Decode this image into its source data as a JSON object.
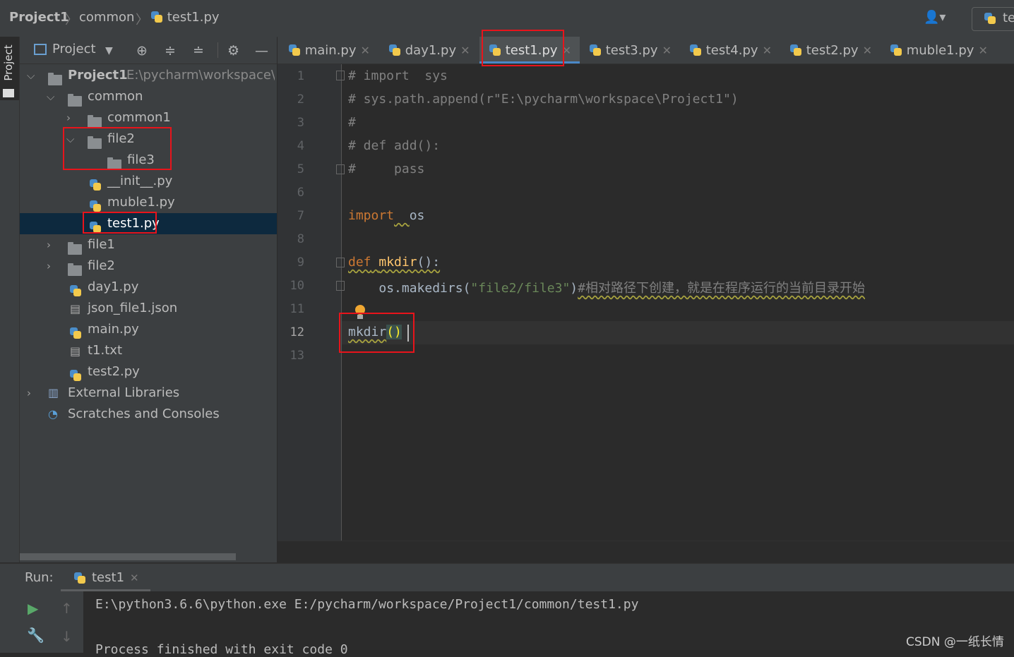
{
  "breadcrumb": {
    "project": "Project1",
    "folder": "common",
    "file": "test1.py",
    "run_config": "te"
  },
  "sidebar_stripe": {
    "label": "Project"
  },
  "project_toolbar": {
    "view_label": "Project"
  },
  "tree": [
    {
      "label": "Project1",
      "path": "E:\\pycharm\\workspace\\P",
      "type": "folder",
      "expanded": true
    },
    {
      "label": "common",
      "type": "folder",
      "expanded": true
    },
    {
      "label": "common1",
      "type": "folder",
      "expanded": false
    },
    {
      "label": "file2",
      "type": "folder",
      "expanded": true
    },
    {
      "label": "file3",
      "type": "folder"
    },
    {
      "label": "__init__.py",
      "type": "python"
    },
    {
      "label": "muble1.py",
      "type": "python"
    },
    {
      "label": "test1.py",
      "type": "python",
      "selected": true
    },
    {
      "label": "file1",
      "type": "folder",
      "expanded": false
    },
    {
      "label": "file2",
      "type": "folder",
      "expanded": false
    },
    {
      "label": "day1.py",
      "type": "python"
    },
    {
      "label": "json_file1.json",
      "type": "json"
    },
    {
      "label": "main.py",
      "type": "python"
    },
    {
      "label": "t1.txt",
      "type": "text"
    },
    {
      "label": "test2.py",
      "type": "python"
    },
    {
      "label": "External Libraries",
      "type": "library"
    },
    {
      "label": "Scratches and Consoles",
      "type": "scratch"
    }
  ],
  "tabs": [
    {
      "label": "main.py"
    },
    {
      "label": "day1.py"
    },
    {
      "label": "test1.py",
      "active": true
    },
    {
      "label": "test3.py"
    },
    {
      "label": "test4.py"
    },
    {
      "label": "test2.py"
    },
    {
      "label": "muble1.py"
    }
  ],
  "line_numbers": [
    "1",
    "2",
    "3",
    "4",
    "5",
    "6",
    "7",
    "8",
    "9",
    "10",
    "11",
    "12",
    "13"
  ],
  "current_line": "12",
  "code": {
    "l1": "# import  sys",
    "l2": "# sys.path.append(r\"E:\\pycharm\\workspace\\Project1\")",
    "l3": "#",
    "l4": "# def add():",
    "l5": "#     pass",
    "l7_kw": "import",
    "l7_mod": "os",
    "l9_kw": "def",
    "l9_fn": "mkdir",
    "l9_tail": "():",
    "l10_call": "os.makedirs(",
    "l10_str": "\"file2/file3\"",
    "l10_close": ")",
    "l10_comment": "#相对路径下创建，就是在程序运行的当前目录开始",
    "l12_fn": "mkdir",
    "l12_paren": "()"
  },
  "run": {
    "label": "Run:",
    "tab": "test1",
    "output_1": "E:\\python3.6.6\\python.exe E:/pycharm/workspace/Project1/common/test1.py",
    "output_2": "Process finished with exit code 0"
  },
  "watermark": "CSDN @一纸长情",
  "colors": {
    "highlight_box": "#e8141b",
    "selection": "#0d293e",
    "keyword": "#cc7832",
    "function": "#ffc66d",
    "string": "#6a8759"
  }
}
